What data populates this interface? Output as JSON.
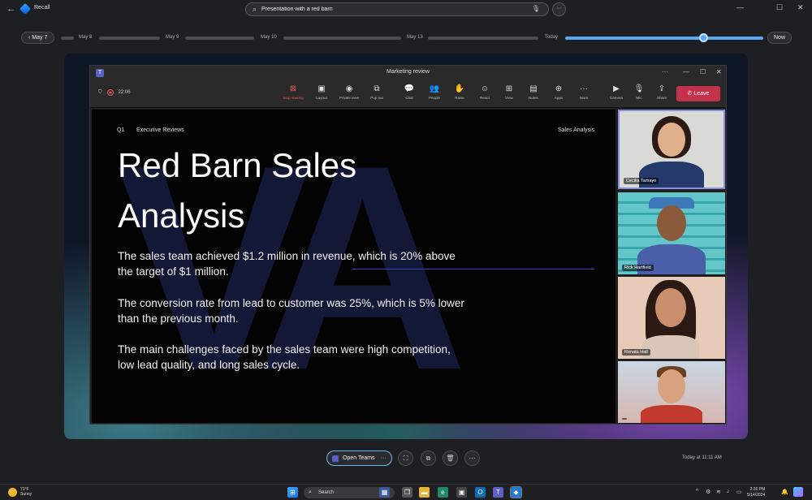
{
  "app": {
    "title": "Recall"
  },
  "search": {
    "value": "Presentation with a red barn"
  },
  "timeline": {
    "current_date": "May 7",
    "labels": [
      "May 8",
      "May 9",
      "May 10",
      "May 13",
      "Today"
    ],
    "now_label": "Now",
    "position": 0.84
  },
  "teams": {
    "window_title": "Marketing review",
    "timer": "22:06",
    "tools": [
      {
        "icon": "stop-sharing-icon",
        "label": "Stop sharing"
      },
      {
        "icon": "layout-icon",
        "label": "Layout"
      },
      {
        "icon": "private-view-icon",
        "label": "Private view"
      },
      {
        "icon": "pop-out-icon",
        "label": "Pop out"
      },
      {
        "icon": "chat-icon",
        "label": "Chat"
      },
      {
        "icon": "people-icon",
        "label": "People"
      },
      {
        "icon": "raise-hand-icon",
        "label": "Raise"
      },
      {
        "icon": "react-icon",
        "label": "React"
      },
      {
        "icon": "view-icon",
        "label": "View"
      },
      {
        "icon": "notes-icon",
        "label": "Notes"
      },
      {
        "icon": "apps-icon",
        "label": "Apps"
      },
      {
        "icon": "more-icon",
        "label": "More"
      },
      {
        "icon": "camera-icon",
        "label": "Camera"
      },
      {
        "icon": "mic-icon",
        "label": "Mic"
      },
      {
        "icon": "share-icon",
        "label": "Share"
      }
    ],
    "leave_label": "Leave"
  },
  "slide": {
    "tag": "Q1",
    "section": "Executive Reviews",
    "right_header": "Sales Analysis",
    "title_line1": "Red Barn Sales",
    "title_line2": "Analysis",
    "para1": "The sales team achieved $1.2 million in revenue, which is 20% above the target of $1 million.",
    "para2": "The conversion rate from lead to customer was 25%, which is 5% lower than the previous month.",
    "para3": "The main challenges faced by the sales team were high competition, low lead quality, and long sales cycle."
  },
  "participants": [
    {
      "name": "Cecilia Tamayo"
    },
    {
      "name": "Rick Hartfield"
    },
    {
      "name": "Renata Hall"
    },
    {
      "name": ""
    }
  ],
  "bottom": {
    "open_teams": "Open Teams",
    "timestamp": "Today at 11:11 AM"
  },
  "taskbar": {
    "temp": "71°F",
    "weather": "Sunny",
    "search": "Search",
    "time": "2:30 PM",
    "date": "5/14/2024"
  },
  "colors": {
    "accent": "#5aa9f0",
    "leave": "#c4314b",
    "teams": "#5b5fc7"
  }
}
